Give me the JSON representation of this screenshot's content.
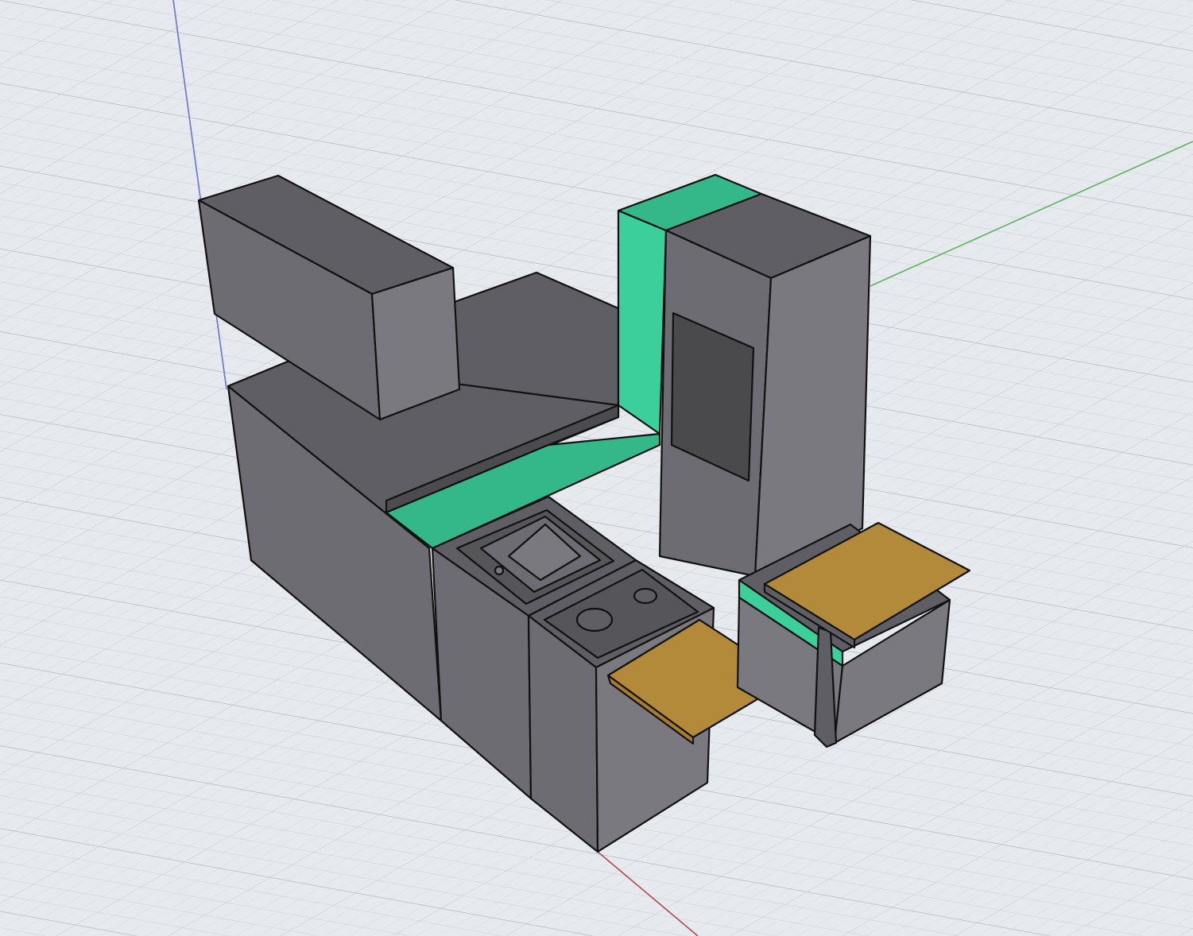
{
  "viewport": {
    "background": "#e6e9ed",
    "grid_minor_color": "#cfd5dd",
    "grid_major_color": "#b8c0ca"
  },
  "axes": {
    "x_color": "#b04a4a",
    "y_color": "#5db35d",
    "z_color": "#6a73c9"
  },
  "materials": {
    "cabinet_top": "#5f5e64",
    "cabinet_left": "#6d6c72",
    "cabinet_right": "#7a7980",
    "accent": "#3ccf9c",
    "accent_dark": "#35b889",
    "wood": "#b38a3a",
    "panel_dark": "#4a4a4c",
    "edge": "#111111"
  },
  "objects": [
    "upper-cabinet",
    "base-counter",
    "back-wall",
    "tall-column",
    "sink-module",
    "stove-module",
    "fold-table-left",
    "dinette-bench",
    "dinette-table"
  ]
}
